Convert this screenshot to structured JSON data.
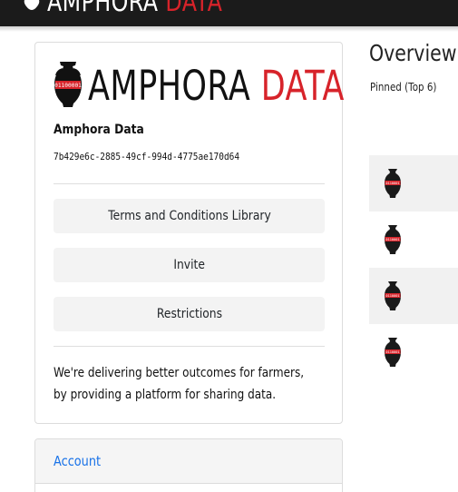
{
  "navbar": {
    "brand_word1": "AMPHORA",
    "brand_word2": "DATA"
  },
  "org_card": {
    "logo_word1": "AMPHORA",
    "logo_word2": "DATA",
    "logo_amphora_text": "01100001",
    "org_name": "Amphora Data",
    "org_id": "7b429e6c-2885-49cf-994d-4775ae170d64",
    "buttons": [
      {
        "label": "Terms and Conditions Library"
      },
      {
        "label": "Invite"
      },
      {
        "label": "Restrictions"
      }
    ],
    "tagline": "We're delivering better outcomes for farmers, by providing a platform for sharing data."
  },
  "account_card": {
    "title": "Account"
  },
  "overview": {
    "title": "Overview",
    "pinned_label": "Pinned (Top 6)",
    "pinned_items": [
      {
        "icon": "amphora-icon",
        "amphora_text": "0110001"
      },
      {
        "icon": "amphora-icon",
        "amphora_text": "0110001"
      },
      {
        "icon": "amphora-icon",
        "amphora_text": "0110001"
      },
      {
        "icon": "amphora-icon",
        "amphora_text": "0110001"
      }
    ]
  },
  "colors": {
    "navbar_bg": "#1b1b1b",
    "brand_red": "#d7232a",
    "link_blue": "#1a73e8",
    "button_bg": "#f3f3f3"
  }
}
